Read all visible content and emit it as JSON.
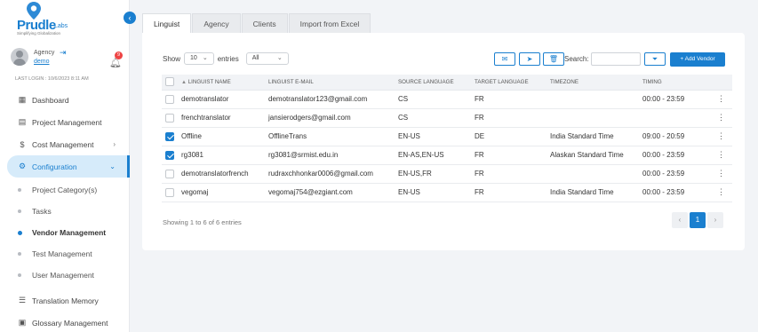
{
  "brand": {
    "name": "Prudle",
    "suffix": "Labs",
    "tagline": "Simplifying Globalization"
  },
  "user": {
    "role": "Agency",
    "name": "demo",
    "notifications": "9",
    "last_login": "LAST LOGIN : 10/6/2023 8:11 AM"
  },
  "sidebar": {
    "items": [
      {
        "label": "Dashboard",
        "icon": "dashboard-icon"
      },
      {
        "label": "Project Management",
        "icon": "calendar-icon"
      },
      {
        "label": "Cost Management",
        "icon": "dollar-icon"
      },
      {
        "label": "Configuration",
        "icon": "gear-icon"
      }
    ],
    "sub_items": [
      {
        "label": "Project Category(s)"
      },
      {
        "label": "Tasks"
      },
      {
        "label": "Vendor Management"
      },
      {
        "label": "Test Management"
      },
      {
        "label": "User Management"
      }
    ],
    "bottom_items": [
      {
        "label": "Translation Memory",
        "icon": "memory-icon"
      },
      {
        "label": "Glossary Management",
        "icon": "book-icon"
      }
    ]
  },
  "tabs": [
    "Linguist",
    "Agency",
    "Clients",
    "Import from Excel"
  ],
  "controls": {
    "show_label": "Show",
    "page_size": "10",
    "entries_label": "entries",
    "filter_value": "All",
    "search_label": "Search:",
    "search_value": "",
    "add_vendor_label": "+ Add Vendor"
  },
  "table": {
    "columns": [
      "LINGUIST NAME",
      "LINGUIST E-MAIL",
      "SOURCE LANGUAGE",
      "TARGET LANGUAGE",
      "TIMEZONE",
      "TIMING"
    ],
    "rows": [
      {
        "checked": false,
        "name": "demotranslator",
        "email": "demotranslator123@gmail.com",
        "source": "CS",
        "target": "FR",
        "timezone": "",
        "timing": "00:00 - 23:59"
      },
      {
        "checked": false,
        "name": "frenchtranslator",
        "email": "jansierodgers@gmail.com",
        "source": "CS",
        "target": "FR",
        "timezone": "",
        "timing": ""
      },
      {
        "checked": true,
        "name": "Offline",
        "email": "OfflineTrans",
        "source": "EN-US",
        "target": "DE",
        "timezone": "India Standard Time",
        "timing": "09:00 - 20:59"
      },
      {
        "checked": true,
        "name": "rg3081",
        "email": "rg3081@srmist.edu.in",
        "source": "EN-AS,EN-US",
        "target": "FR",
        "timezone": "Alaskan Standard Time",
        "timing": "00:00 - 23:59"
      },
      {
        "checked": false,
        "name": "demotranslatorfrench",
        "email": "rudraxchhonkar0006@gmail.com",
        "source": "EN-US,FR",
        "target": "FR",
        "timezone": "",
        "timing": "00:00 - 23:59"
      },
      {
        "checked": false,
        "name": "vegomaj",
        "email": "vegomaj754@ezgiant.com",
        "source": "EN-US",
        "target": "FR",
        "timezone": "India Standard Time",
        "timing": "00:00 - 23:59"
      }
    ]
  },
  "footer": {
    "showing": "Showing 1 to 6 of 6 entries",
    "current_page": "1"
  },
  "colors": {
    "accent": "#1a7fcf",
    "active_bg": "#d6ebfa"
  }
}
